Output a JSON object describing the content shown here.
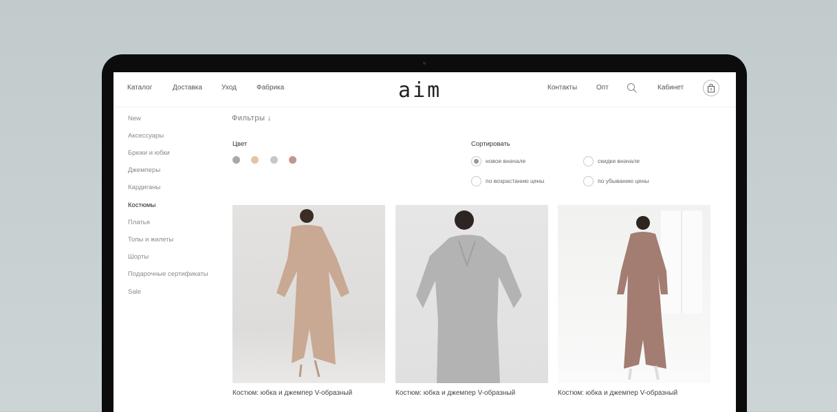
{
  "header": {
    "nav_left": [
      "Каталог",
      "Доставка",
      "Уход",
      "Фабрика"
    ],
    "logo": "aim",
    "nav_right": {
      "contacts": "Контакты",
      "wholesale": "Опт",
      "account": "Кабинет"
    },
    "icons": {
      "search": "search-icon",
      "cart": "shopping-bag-icon"
    }
  },
  "sidebar": {
    "items": [
      "New",
      "Аксессуары",
      "Брюки и юбки",
      "Джемперы",
      "Кардиганы",
      "Костюмы",
      "Платья",
      "Топы и жилеты",
      "Шорты",
      "Подарочные сертификаты",
      "Sale"
    ],
    "active": "Костюмы"
  },
  "filters": {
    "toggle_label": "Фильтры ↓",
    "color_label": "Цвет",
    "colors": [
      "#a9a9a9",
      "#e6c3a6",
      "#c7c7c7",
      "#c59494"
    ]
  },
  "sort": {
    "label": "Сортировать",
    "options": [
      {
        "label": "новое вначале",
        "selected": true
      },
      {
        "label": "скидки вначале",
        "selected": false
      },
      {
        "label": "по возрастанию цены",
        "selected": false
      },
      {
        "label": "по убыванию цены",
        "selected": false
      }
    ]
  },
  "products": [
    {
      "title": "Костюм: юбка и джемпер V-образный",
      "color": "#c9a993"
    },
    {
      "title": "Костюм: юбка и джемпер V-образный",
      "color": "#b3b3b3"
    },
    {
      "title": "Костюм: юбка и джемпер V-образный",
      "color": "#a37c72"
    }
  ]
}
